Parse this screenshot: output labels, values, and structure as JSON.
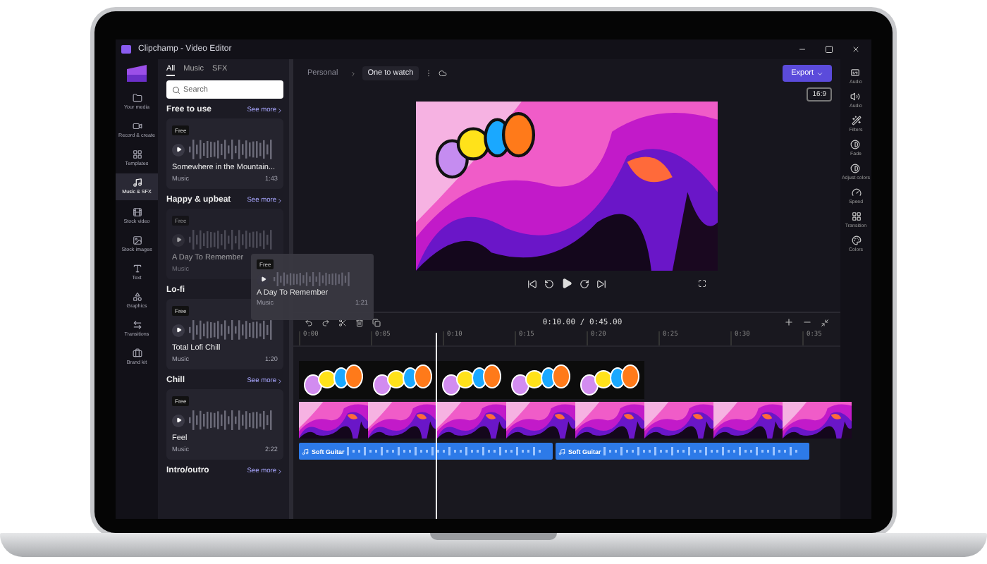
{
  "window": {
    "title": "Clipchamp - Video Editor"
  },
  "nav": [
    {
      "label": "Your media",
      "selected": false
    },
    {
      "label": "Record & create",
      "selected": false
    },
    {
      "label": "Templates",
      "selected": false
    },
    {
      "label": "Music & SFX",
      "selected": true
    },
    {
      "label": "Stock video",
      "selected": false
    },
    {
      "label": "Stock images",
      "selected": false
    },
    {
      "label": "Text",
      "selected": false
    },
    {
      "label": "Graphics",
      "selected": false
    },
    {
      "label": "Transitions",
      "selected": false
    },
    {
      "label": "Brand kit",
      "selected": false
    }
  ],
  "library": {
    "tabs": [
      {
        "label": "All",
        "selected": true
      },
      {
        "label": "Music",
        "selected": false
      },
      {
        "label": "SFX",
        "selected": false
      }
    ],
    "search": {
      "placeholder": "Search"
    },
    "sections": [
      {
        "title": "Free to use",
        "see_more": "See more",
        "track": {
          "badge": "Free",
          "name": "Somewhere in the Mountain...",
          "type": "Music",
          "duration": "1:43",
          "dragging": false
        }
      },
      {
        "title": "Happy & upbeat",
        "see_more": "See more",
        "track": {
          "badge": "Free",
          "name": "A Day To Remember",
          "type": "Music",
          "dragging": true
        }
      },
      {
        "title": "Lo-fi",
        "track": {
          "badge": "Free",
          "name": "Total Lofi Chill",
          "type": "Music",
          "duration": "1:20",
          "dragging": false
        }
      },
      {
        "title": "Chill",
        "see_more": "See more",
        "track": {
          "badge": "Free",
          "name": "Feel",
          "type": "Music",
          "duration": "2:22",
          "dragging": false
        }
      },
      {
        "title": "Intro/outro",
        "see_more": "See more"
      }
    ]
  },
  "drag_preview": {
    "badge": "Free",
    "name": "A Day To Remember",
    "type": "Music",
    "duration": "1:21"
  },
  "breadcrumb": [
    "Personal",
    "One to watch"
  ],
  "export": "Export",
  "aspect": "16:9",
  "time": "0:10.00 / 0:45.00",
  "ruler": [
    "0:00",
    "0:05",
    "0:10",
    "0:15",
    "0:20",
    "0:25",
    "0:30",
    "0:35"
  ],
  "audio_clips": [
    "Soft Guitar",
    "Soft Guitar"
  ],
  "tools": [
    "Audio",
    "Audio",
    "Filters",
    "Fade",
    "Adjust colors",
    "Speed",
    "Transition",
    "Colors"
  ]
}
